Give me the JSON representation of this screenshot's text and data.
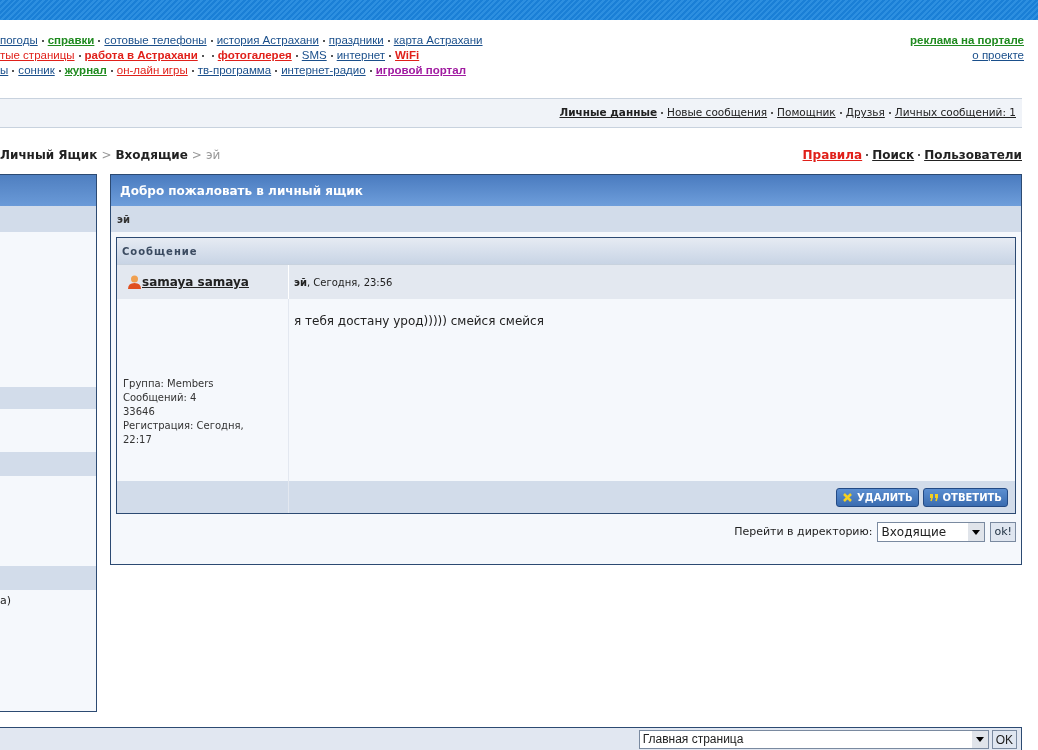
{
  "nav_rows": [
    [
      {
        "text": "погоды",
        "kind": "plain"
      },
      {
        "text": "справки",
        "kind": "green"
      },
      {
        "text": "сотовые телефоны",
        "kind": "plain"
      },
      {
        "text": "история Астрахани",
        "kind": "plain"
      },
      {
        "text": "праздники",
        "kind": "plain"
      },
      {
        "text": "карта Астрахани",
        "kind": "plain"
      }
    ],
    [
      {
        "text": "тые страницы",
        "kind": "red"
      },
      {
        "text": "работа в Астрахани",
        "kind": "red-bold",
        "extra_dot": true
      },
      {
        "text": "фотогалерея",
        "kind": "red-bold"
      },
      {
        "text": "SMS",
        "kind": "plain"
      },
      {
        "text": "интернет",
        "kind": "plain"
      },
      {
        "text": "WiFi",
        "kind": "red-bold"
      }
    ],
    [
      {
        "text": "ы",
        "kind": "plain"
      },
      {
        "text": "сонник",
        "kind": "plain"
      },
      {
        "text": "журнал",
        "kind": "green"
      },
      {
        "text": "он-лайн игры",
        "kind": "red"
      },
      {
        "text": "тв-программа",
        "kind": "plain"
      },
      {
        "text": "интернет-радио",
        "kind": "plain"
      },
      {
        "text": "игровой портал",
        "kind": "purple"
      }
    ]
  ],
  "header_links": [
    {
      "text": "реклама на портале",
      "kind": "green"
    },
    {
      "text": "о проекте",
      "kind": "plain"
    }
  ],
  "user_bar": [
    {
      "text": "Личные данные",
      "bold": true
    },
    {
      "text": "Новые сообщения",
      "bold": false
    },
    {
      "text": "Помощник",
      "bold": false
    },
    {
      "text": "Друзья",
      "bold": false
    },
    {
      "text": "Личных сообщений: 1",
      "bold": false
    }
  ],
  "breadcrumb": [
    {
      "text": "Личный Ящик",
      "current": false
    },
    {
      "text": "Входящие",
      "current": false
    },
    {
      "text": "эй",
      "current": true
    }
  ],
  "breadcrumb_separator": ">",
  "top_links": [
    {
      "text": "Правила",
      "kind": "red"
    },
    {
      "text": "Поиск",
      "kind": "plain"
    },
    {
      "text": "Пользователи",
      "kind": "plain"
    }
  ],
  "sidebar": {
    "text": "а)"
  },
  "panel": {
    "title": "Добро пожаловать в личный ящик",
    "subject": "эй",
    "message": {
      "header": "Сообщение",
      "author": "samaya samaya",
      "meta_title": "эй",
      "meta_date": ", Сегодня, 23:56",
      "body": "я тебя достану урод))))) смейся смейся",
      "author_info": [
        "Группа: Members",
        "Сообщений: 4",
        "33646",
        "Регистрация: Сегодня,",
        "22:17"
      ],
      "buttons": [
        {
          "label": "УДАЛИТЬ",
          "kind": "delete"
        },
        {
          "label": "ОТВЕТИТЬ",
          "kind": "reply"
        }
      ]
    },
    "jump": {
      "label": "Перейти в директорию:",
      "value": "Входящие",
      "button": "ok!"
    }
  },
  "footer": {
    "value": "Главная страница",
    "button": "OK"
  }
}
